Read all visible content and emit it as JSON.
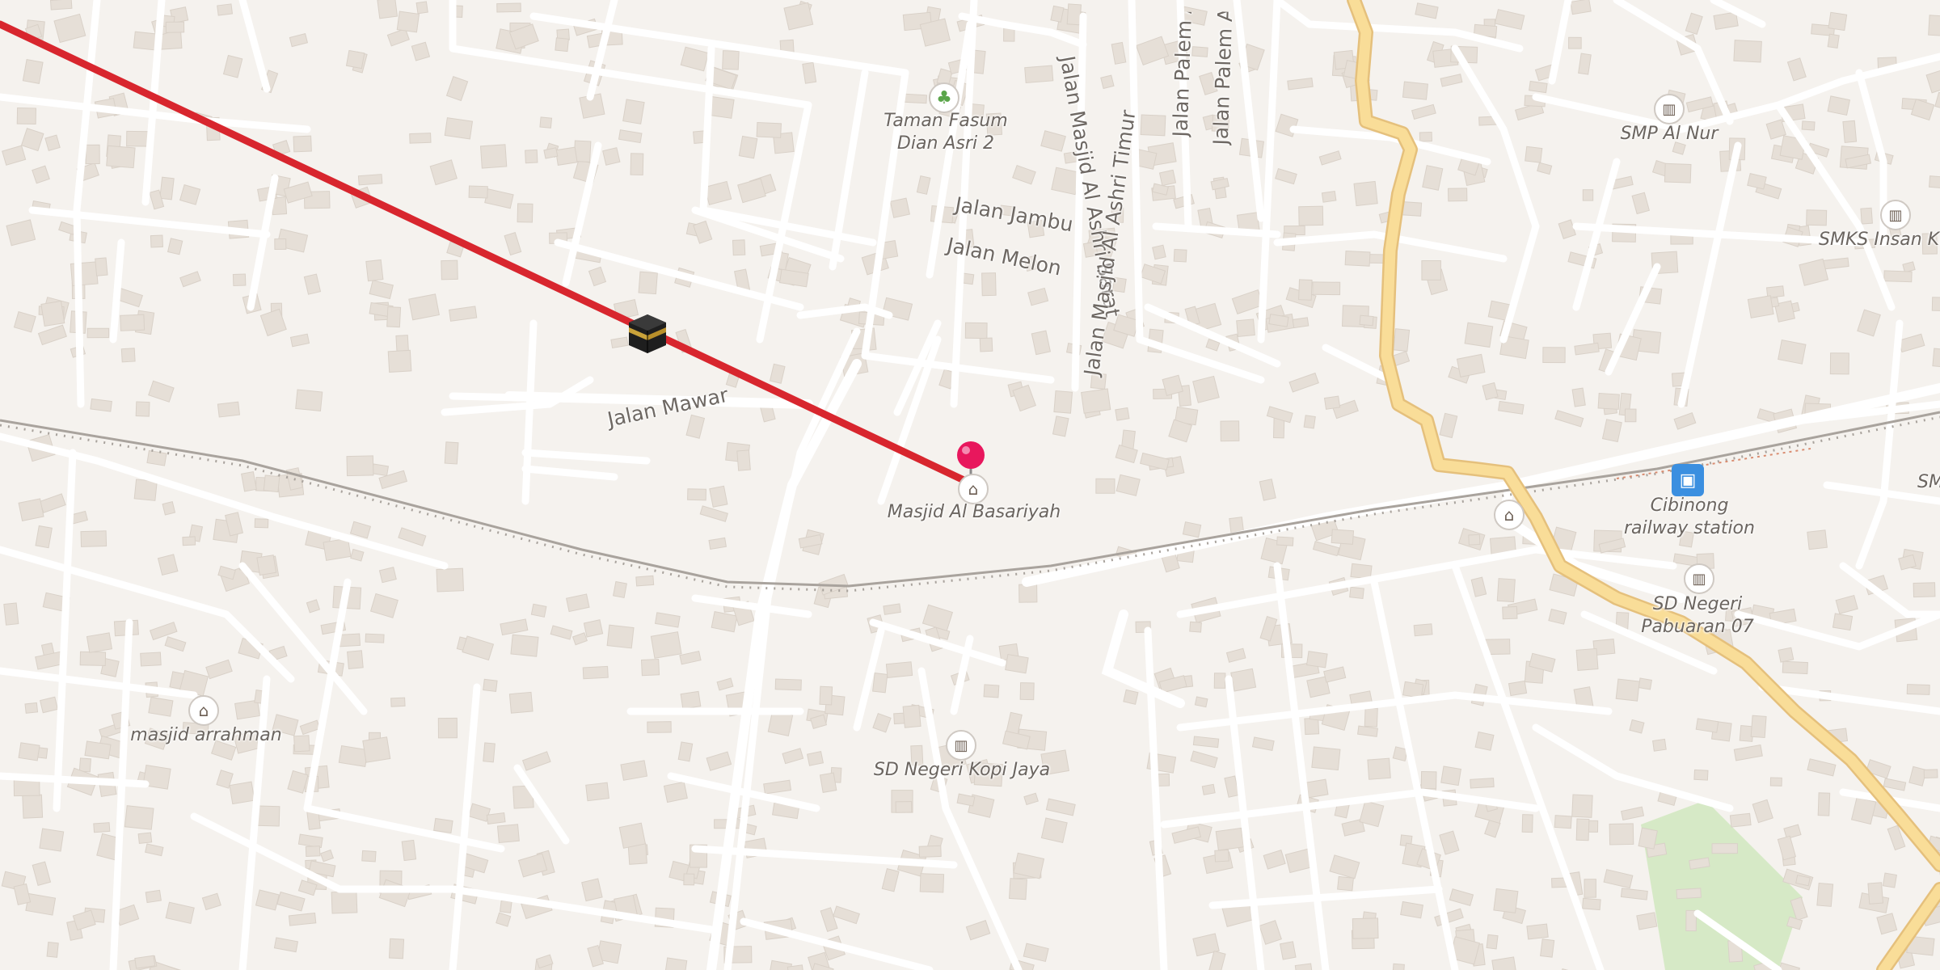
{
  "map": {
    "colors": {
      "background": "#f5f2ee",
      "building": "#e4ddd5",
      "road": "#ffffff",
      "main_road": "#f7d68c",
      "qibla_line": "#d8262e",
      "railway": "#a9a39d",
      "park": "#d6e9c6",
      "pin": "#e8175d",
      "rail_station": "#3b8fe0"
    }
  },
  "qibla": {
    "kaaba_icon": "kaaba-icon",
    "pin_icon": "map-pin-icon"
  },
  "streets": {
    "mawar": "Jalan Mawar",
    "jambu": "Jalan Jambu",
    "melon": "Jalan Melon",
    "ashri_barat": "Jalan Masjid Al Ashri Barat",
    "ashri_timur": "Jalan Masjid Al Ashri Timur",
    "palem_a": "Jalan Palem A",
    "palem_as": "Jalan Palem As"
  },
  "pois": {
    "taman_fasum": {
      "line1": "Taman Fasum",
      "line2": "Dian Asri 2",
      "icon": "tree-icon"
    },
    "masjid_basariyah": {
      "name": "Masjid Al Basariyah",
      "icon": "mosque-icon"
    },
    "masjid_arrahman": {
      "name": "masjid arrahman",
      "icon": "mosque-icon"
    },
    "sd_kopi_jaya": {
      "name": "SD Negeri Kopi Jaya",
      "icon": "school-icon"
    },
    "smp_al_nur": {
      "name": "SMP Al Nur",
      "icon": "school-icon"
    },
    "smks_insan": {
      "name": "SMKS Insan Kr",
      "icon": "school-icon"
    },
    "cibinong_station": {
      "line1": "Cibinong",
      "line2": "railway station",
      "icon": "train-icon"
    },
    "sd_pabuaran": {
      "line1": "SD Negeri",
      "line2": "Pabuaran 07",
      "icon": "school-icon"
    },
    "sm_edge": {
      "name": "SM"
    },
    "mosque_station": {
      "icon": "mosque-icon"
    }
  }
}
